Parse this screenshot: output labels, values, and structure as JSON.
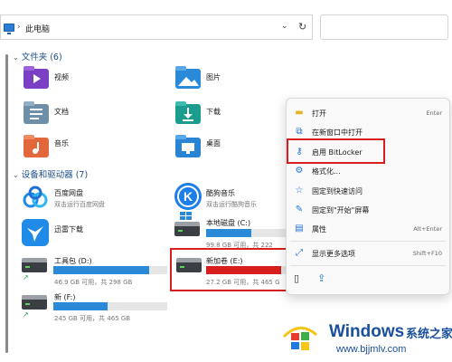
{
  "address_bar": {
    "location": "此电脑"
  },
  "sections": {
    "folders": "文件夹 (6)",
    "devices": "设备和驱动器 (7)"
  },
  "folders": [
    {
      "name": "视频",
      "icon": "video-folder-icon",
      "color": "#7b3fc4"
    },
    {
      "name": "图片",
      "icon": "pictures-folder-icon",
      "color": "#2b8ad8"
    },
    {
      "name": "文档",
      "icon": "documents-folder-icon",
      "color": "#6f8fa8"
    },
    {
      "name": "下载",
      "icon": "downloads-folder-icon",
      "color": "#1c9b8f"
    },
    {
      "name": "音乐",
      "icon": "music-folder-icon",
      "color": "#e2673a"
    },
    {
      "name": "桌面",
      "icon": "desktop-folder-icon",
      "color": "#2a84d6"
    }
  ],
  "apps": [
    {
      "name": "百度网盘",
      "sub": "双击运行百度网盘",
      "icon": "baidu-netdisk-icon"
    },
    {
      "name": "酷狗音乐",
      "sub": "双击运行酷狗音乐",
      "icon": "kugou-music-icon"
    },
    {
      "name": "迅雷下载",
      "icon": "xunlei-icon"
    }
  ],
  "drives": [
    {
      "name": "本地磁盘 (C:)",
      "info": "99.8 GB 可用，共 222",
      "used_fraction": 0.55,
      "bar_color": "#2b8ad8"
    },
    {
      "name": "工具包 (D:)",
      "info": "46.9 GB 可用，共 298 GB",
      "used_fraction": 0.84,
      "bar_color": "#2b8ad8"
    },
    {
      "name": "新加卷 (E:)",
      "info": "27.2 GB 可用，共 465 G",
      "used_fraction": 0.94,
      "bar_color": "#d81e1e"
    },
    {
      "name": "新 (F:)",
      "info": "245 GB 可用，共 465 GB",
      "used_fraction": 0.48,
      "bar_color": "#2b8ad8"
    }
  ],
  "context_menu": {
    "items": [
      {
        "label": "打开",
        "shortcut": "Enter",
        "icon": "open-folder-icon"
      },
      {
        "label": "在新窗口中打开",
        "shortcut": "",
        "icon": "new-window-icon"
      },
      {
        "label": "启用 BitLocker",
        "shortcut": "",
        "icon": "key-icon"
      },
      {
        "label": "格式化...",
        "shortcut": "",
        "icon": "format-icon"
      },
      {
        "label": "固定到快速访问",
        "shortcut": "",
        "icon": "star-icon"
      },
      {
        "label": "固定到\"开始\"屏幕",
        "shortcut": "",
        "icon": "pin-icon"
      },
      {
        "label": "属性",
        "shortcut": "Alt+Enter",
        "icon": "properties-icon"
      },
      {
        "label": "显示更多选项",
        "shortcut": "Shift+F10",
        "icon": "more-options-icon"
      }
    ]
  },
  "watermark": {
    "brand": "Windows",
    "cn": "系统之家",
    "url": "www.bjjmlv.com"
  },
  "colors": {
    "accent": "#2b8ad8",
    "highlight": "#d81e1e"
  }
}
